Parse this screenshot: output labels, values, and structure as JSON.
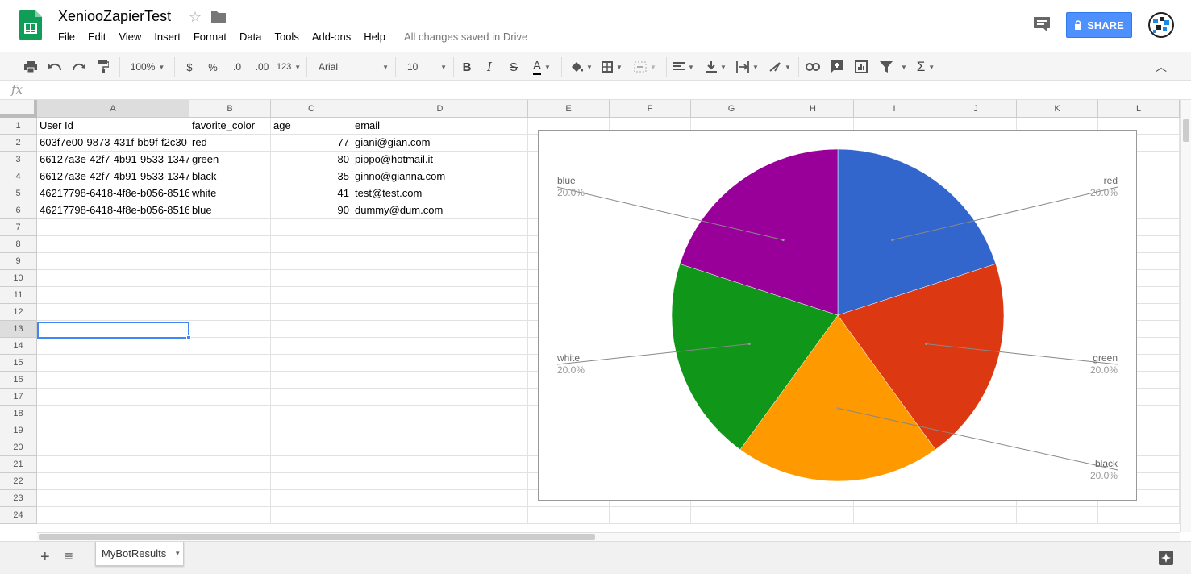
{
  "app": {
    "doc_title": "XeniooZapierTest",
    "save_status": "All changes saved in Drive",
    "share_label": "SHARE",
    "brand_color": "#0f9d58"
  },
  "menu": [
    "File",
    "Edit",
    "View",
    "Insert",
    "Format",
    "Data",
    "Tools",
    "Add-ons",
    "Help"
  ],
  "toolbar": {
    "zoom": "100%",
    "currency": "$",
    "percent": "%",
    "decrease_decimals": ".0",
    "increase_decimals": ".00",
    "more_formats": "123",
    "font": "Arial",
    "font_size": "10",
    "bold": "B",
    "italic": "I",
    "strikethrough": "S",
    "text_color": "A"
  },
  "formula_bar": {
    "fx": "fx",
    "content": ""
  },
  "columns": [
    "A",
    "B",
    "C",
    "D",
    "E",
    "F",
    "G",
    "H",
    "I",
    "J",
    "K",
    "L"
  ],
  "rows": [
    "1",
    "2",
    "3",
    "4",
    "5",
    "6",
    "7",
    "8",
    "9",
    "10",
    "11",
    "12",
    "13",
    "14",
    "15",
    "16",
    "17",
    "18",
    "19",
    "20",
    "21",
    "22",
    "23",
    "24"
  ],
  "selected_cell": "A13",
  "table": {
    "headers": [
      "User Id",
      "favorite_color",
      "age",
      "email"
    ],
    "rows": [
      [
        "603f7e00-9873-431f-bb9f-f2c30",
        "red",
        "77",
        "giani@gian.com"
      ],
      [
        "66127a3e-42f7-4b91-9533-1347",
        "green",
        "80",
        "pippo@hotmail.it"
      ],
      [
        "66127a3e-42f7-4b91-9533-1347",
        "black",
        "35",
        "ginno@gianna.com"
      ],
      [
        "46217798-6418-4f8e-b056-8516",
        "white",
        "41",
        "test@test.com"
      ],
      [
        "46217798-6418-4f8e-b056-8516",
        "blue",
        "90",
        "dummy@dum.com"
      ]
    ]
  },
  "chart_data": {
    "type": "pie",
    "categories": [
      "red",
      "green",
      "black",
      "white",
      "blue"
    ],
    "values": [
      1,
      1,
      1,
      1,
      1
    ],
    "percent_labels": [
      "20.0%",
      "20.0%",
      "20.0%",
      "20.0%",
      "20.0%"
    ],
    "colors": [
      "#3366cc",
      "#dc3912",
      "#ff9900",
      "#109618",
      "#990099"
    ],
    "legend": "labeled",
    "title": ""
  },
  "sheet_tab": "MyBotResults"
}
